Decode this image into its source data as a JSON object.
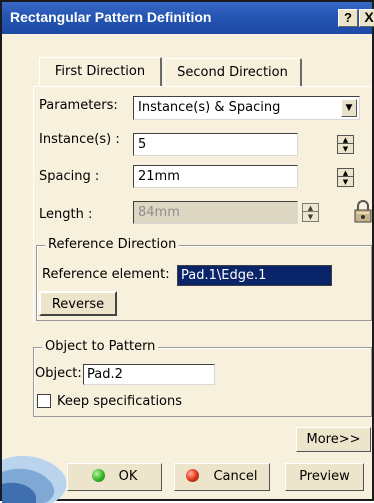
{
  "window": {
    "title": "Rectangular Pattern Definition",
    "help_label": "?",
    "close_label": "X"
  },
  "tabs": [
    {
      "label": "First Direction",
      "selected": true
    },
    {
      "label": "Second Direction",
      "selected": false
    }
  ],
  "parameters": {
    "label": "Parameters:",
    "value": "Instance(s) & Spacing"
  },
  "instances": {
    "label": "Instance(s) :",
    "value": "5"
  },
  "spacing": {
    "label": "Spacing :",
    "value": "21mm"
  },
  "length": {
    "label": "Length :",
    "value": "84mm"
  },
  "reference_direction": {
    "title": "Reference Direction",
    "element_label": "Reference element:",
    "element_value": "Pad.1\\Edge.1",
    "reverse_label": "Reverse"
  },
  "object_to_pattern": {
    "title": "Object to Pattern",
    "object_label": "Object:",
    "object_value": "Pad.2",
    "keep_spec_label": "Keep specifications",
    "keep_spec_checked": false
  },
  "buttons": {
    "more": "More>>",
    "ok": "OK",
    "cancel": "Cancel",
    "preview": "Preview"
  },
  "colors": {
    "titlebar": "#2555b3",
    "background": "#f7f0dc",
    "selection": "#0a246a"
  }
}
